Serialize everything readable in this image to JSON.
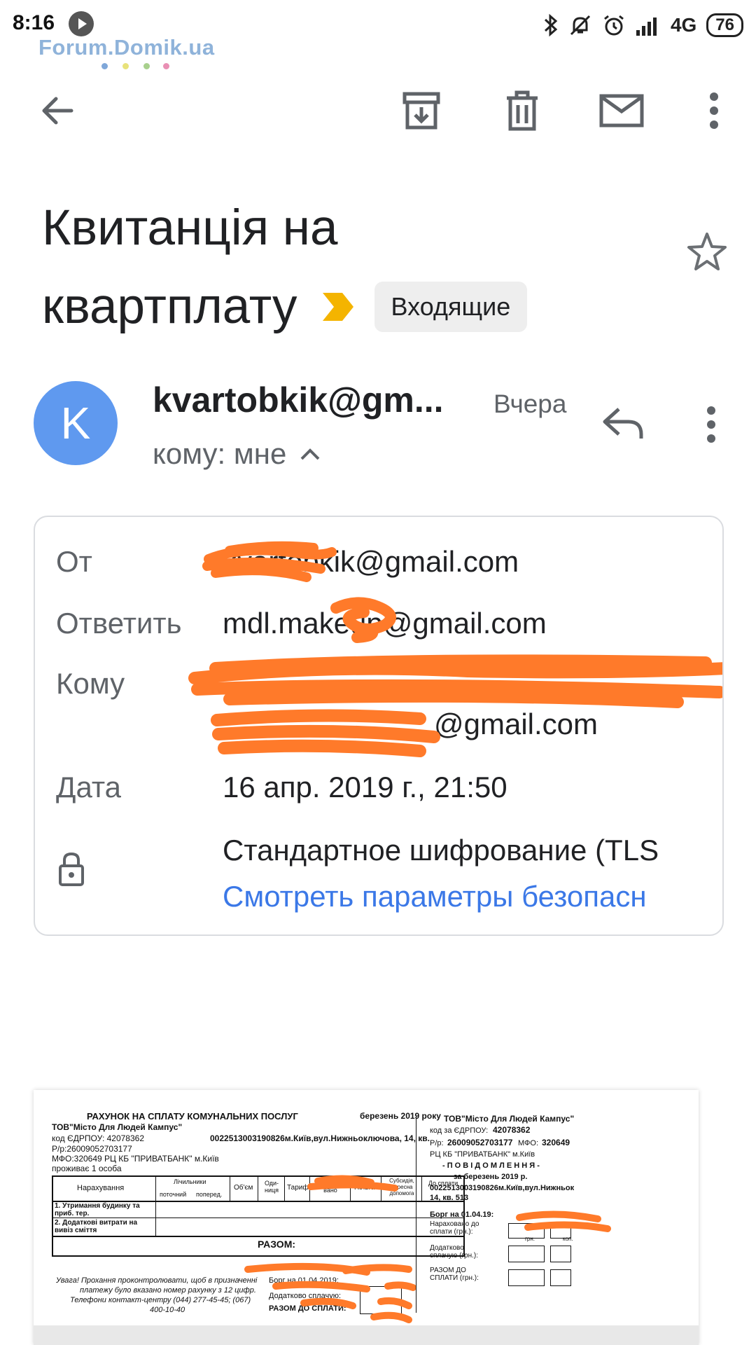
{
  "status_bar": {
    "time": "8:16",
    "network": "4G",
    "battery": "76"
  },
  "watermark": {
    "text": "Forum.Domik.ua",
    "dot_colors": [
      "#7fa7d9",
      "#e8e27a",
      "#a8d08d",
      "#e98fb4"
    ]
  },
  "toolbar": {
    "back_icon": "arrow-back-icon",
    "archive_icon": "archive-icon",
    "delete_icon": "trash-icon",
    "mark_unread_icon": "mail-icon",
    "more_icon": "more-vert-icon"
  },
  "subject": {
    "line1": "Квитанція на",
    "line2": "квартплату",
    "label_chip": "Входящие",
    "importance_color": "#f4b400"
  },
  "sender": {
    "avatar_letter": "K",
    "avatar_color": "#5f99ef",
    "name": "kvartobkik@gm...",
    "date": "Вчера",
    "to_line": "кому: мне"
  },
  "details": {
    "from_label": "От",
    "from_value": "kvartobkik@gmail.com",
    "reply_label": "Ответить",
    "reply_value": "mdl.makeup@gmail.com",
    "to_label": "Кому",
    "to_value": "@gmail.com",
    "date_label": "Дата",
    "date_value": "16 апр. 2019 г., 21:50",
    "encryption": "Стандартное шифрование (TLS",
    "security_link": "Смотреть параметры безопасн"
  },
  "attachment": {
    "title": "РАХУНОК НА СПЛАТУ КОМУНАЛЬНИХ ПОСЛУГ",
    "period": "березень  2019 року",
    "company": "ТОВ\"Місто Для Людей Кампус\"",
    "edrpou": "код ЄДРПОУ: 42078362",
    "account_line": "0022513003190826м.Київ,вул.Нижньоключова, 14, кв.",
    "rr": "Р/р:26009052703177",
    "mfo": "МФО:320649   РЦ КБ \"ПРИВАТБАНК\" м.Київ",
    "lives": "проживає 1 особа",
    "table_headers": [
      "Нарахування",
      "Лічильники",
      "Об'єм",
      "Оди-ниця",
      "Тариф",
      "Нарахо-вано",
      "Пільга",
      "Субсидія, адресна допомога",
      "До сплати"
    ],
    "meters_sub": [
      "поточний",
      "поперед."
    ],
    "row1": "1. Утримання будинку та приб. тер.",
    "row2": "2. Додаткові витрати на вивіз сміття",
    "total": "РАЗОМ:",
    "note1": "Увага! Прохання проконтролювати, щоб в призначенні",
    "note2": "платежу було вказано номер рахунку з 12 цифр.",
    "note3": "Телефони контакт-центру (044) 277-45-45; (067)",
    "note4": "400-10-40",
    "debt": "Борг на 01.04.2019:",
    "extra_paid": "Додатково сплачую:",
    "to_pay": "РАЗОМ ДО СПЛАТИ:",
    "r_company": "ТОВ\"Місто Для Людей Кампус\"",
    "r_edrpou_label": "код за ЄДРПОУ:",
    "r_edrpou": "42078362",
    "r_rr_label": "Р/р:",
    "r_rr": "26009052703177",
    "r_mfo_label": "МФО:",
    "r_mfo": "320649",
    "r_bank": "РЦ КБ \"ПРИВАТБАНК\" м.Київ",
    "r_notice": "- П О В І Д О М Л Е Н Н Я -",
    "r_for": "за березень  2019 р.",
    "r_account": "0022513003190826м.Київ,вул.Нижньок",
    "r_flat": "14, кв. 513",
    "r_debt": "Борг на 01.04.19:",
    "r_accrued": "Нараховано до сплати (грн.):",
    "r_extra": "Додатково сплачую (грн.):",
    "r_total": "РАЗОМ ДО СПЛАТИ (грн.):",
    "r_grn": "грн.",
    "r_kop": "коп."
  }
}
